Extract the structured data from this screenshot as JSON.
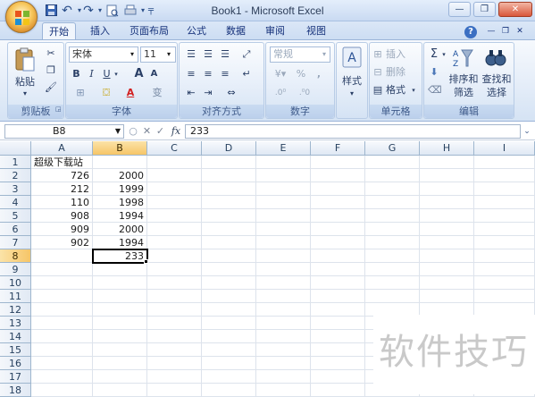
{
  "window": {
    "title": "Book1 - Microsoft Excel",
    "minimize_glyph": "—",
    "restore_glyph": "❐",
    "close_glyph": "✕",
    "inner_minimize_glyph": "—",
    "inner_restore_glyph": "❐",
    "inner_close_glyph": "✕",
    "help_glyph": "?"
  },
  "quick_access": {
    "save_icon": "save-icon",
    "undo_icon": "undo-icon",
    "redo_icon": "redo-icon",
    "print_preview_icon": "print-preview-icon",
    "customize_icon": "dropdown-icon"
  },
  "tabs": [
    "开始",
    "插入",
    "页面布局",
    "公式",
    "数据",
    "审阅",
    "视图"
  ],
  "ribbon": {
    "clipboard": {
      "paste_label": "粘贴",
      "group_label": "剪贴板"
    },
    "font": {
      "font_name": "宋体",
      "font_size": "11",
      "bold": "B",
      "italic": "I",
      "underline": "U",
      "grow": "A",
      "shrink": "A",
      "font_color": "A",
      "wen": "变",
      "group_label": "字体"
    },
    "alignment": {
      "group_label": "对齐方式"
    },
    "number": {
      "format": "常规",
      "percent": "%",
      "comma": ",",
      "group_label": "数字"
    },
    "styles": {
      "label": "样式"
    },
    "cells": {
      "insert": "插入",
      "delete": "删除",
      "format": "格式",
      "group_label": "单元格"
    },
    "editing": {
      "sum_glyph": "Σ",
      "sort_filter_line1": "排序和",
      "sort_filter_line2": "筛选",
      "find_select_line1": "查找和",
      "find_select_line2": "选择",
      "group_label": "编辑"
    }
  },
  "formula_bar": {
    "name_box": "B8",
    "fx": "fx",
    "cancel": "✕",
    "enter": "✓",
    "value": "233"
  },
  "sheet": {
    "columns": [
      "A",
      "B",
      "C",
      "D",
      "E",
      "F",
      "G",
      "H",
      "I"
    ],
    "rows": [
      "1",
      "2",
      "3",
      "4",
      "5",
      "6",
      "7",
      "8",
      "9",
      "10",
      "11",
      "12",
      "13",
      "14",
      "15",
      "16",
      "17",
      "18"
    ],
    "cells": {
      "A1": "超级下载站",
      "A2": "726",
      "B2": "2000",
      "A3": "212",
      "B3": "1999",
      "A4": "110",
      "B4": "1998",
      "A5": "908",
      "B5": "1994",
      "A6": "909",
      "B6": "2000",
      "A7": "902",
      "B7": "1994",
      "B8": "233"
    },
    "active_cell": "B8"
  },
  "watermark": "软件技巧"
}
